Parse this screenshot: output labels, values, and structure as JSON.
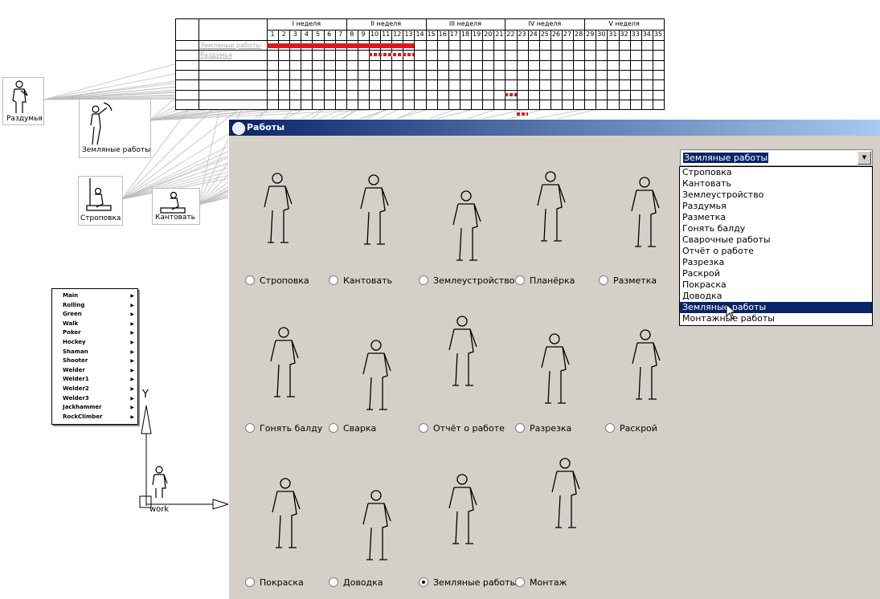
{
  "gantt": {
    "weeks": [
      "I неделя",
      "II неделя",
      "III неделя",
      "IV неделя",
      "V неделя"
    ],
    "days": [
      "1",
      "2",
      "3",
      "4",
      "5",
      "6",
      "7",
      "8",
      "9",
      "10",
      "11",
      "12",
      "13",
      "14",
      "15",
      "16",
      "17",
      "18",
      "19",
      "20",
      "21",
      "22",
      "23",
      "24",
      "25",
      "26",
      "27",
      "28",
      "29",
      "30",
      "31",
      "32",
      "33",
      "34",
      "35"
    ],
    "rows": [
      "Земляные работы",
      "Раздумья"
    ]
  },
  "thumbs": [
    {
      "label": "Раздумья"
    },
    {
      "label": "Земляные работы"
    },
    {
      "label": "Строповка"
    },
    {
      "label": "Кантовать"
    }
  ],
  "menu": {
    "items": [
      "Main",
      "Rolling",
      "Green",
      "Walk",
      "Poker",
      "Hockey",
      "Shaman",
      "Shooter",
      "Welder",
      "Welder1",
      "Welder2",
      "Welder3",
      "Jackhammer",
      "RockClimber"
    ]
  },
  "axes": {
    "y_label": "Y",
    "origin_label": "work"
  },
  "dialog": {
    "title": "Работы",
    "options": [
      {
        "label": "Строповка",
        "selected": false
      },
      {
        "label": "Кантовать",
        "selected": false
      },
      {
        "label": "Землеустройство",
        "selected": false
      },
      {
        "label": "Планёрка",
        "selected": false
      },
      {
        "label": "Разметка",
        "selected": false
      },
      {
        "label": "Гонять балду",
        "selected": false
      },
      {
        "label": "Сварка",
        "selected": false
      },
      {
        "label": "Отчёт о работе",
        "selected": false
      },
      {
        "label": "Разрезка",
        "selected": false
      },
      {
        "label": "Раскрой",
        "selected": false
      },
      {
        "label": "Покраска",
        "selected": false
      },
      {
        "label": "Доводка",
        "selected": false
      },
      {
        "label": "Земляные работы",
        "selected": true
      },
      {
        "label": "Монтаж",
        "selected": false
      }
    ],
    "combo_value": "Земляные работы",
    "dropdown_items": [
      "Строповка",
      "Кантовать",
      "Землеустройство",
      "Раздумья",
      "Разметка",
      "Гонять балду",
      "Сварочные работы",
      "Отчёт о работе",
      "Разрезка",
      "Раскрой",
      "Покраска",
      "Доводка",
      "Земляные работы",
      "Монтажные работы"
    ],
    "dropdown_selected": "Земляные работы"
  },
  "colors": {
    "title_bar": "#0a246a",
    "dialog_bg": "#d4d0c8",
    "gantt_bar": "#e01818"
  }
}
